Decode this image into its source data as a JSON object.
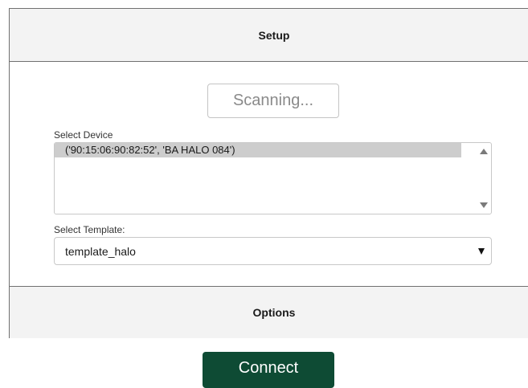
{
  "setup": {
    "title": "Setup",
    "scan_button_label": "Scanning..."
  },
  "device_select": {
    "label": "Select Device",
    "items": [
      {
        "label": "('90:15:06:90:82:52', 'BA HALO 084')",
        "selected": true
      }
    ],
    "scroll_up_icon": "triangle-up-icon",
    "scroll_down_icon": "triangle-down-icon"
  },
  "template_select": {
    "label": "Select Template:",
    "value": "template_halo",
    "caret_icon": "caret-down-icon"
  },
  "options": {
    "title": "Options"
  },
  "connect": {
    "label": "Connect",
    "background": "#0e4b34"
  }
}
